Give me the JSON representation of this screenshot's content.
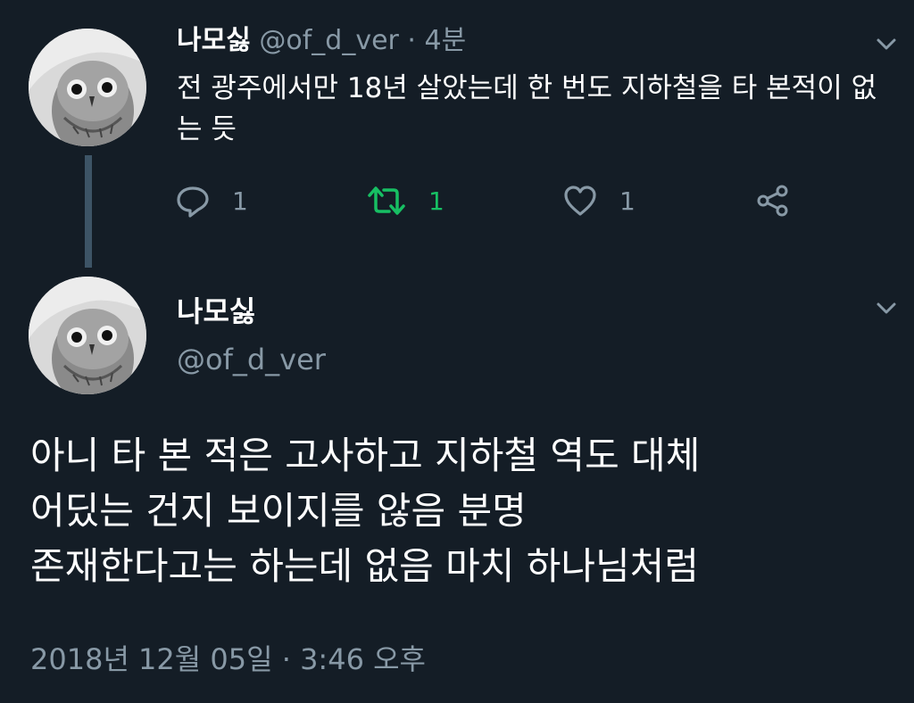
{
  "tweet1": {
    "display_name": "나모싫",
    "handle": "@of_d_ver",
    "separator": "·",
    "time_ago": "4분",
    "text": "전 광주에서만 18년 살았는데 한 번도 지하철을 타 본적이 없는 듯",
    "avatar_icon": "owl-avatar-icon",
    "actions": {
      "reply_count": "1",
      "retweet_count": "1",
      "like_count": "1"
    },
    "retweet_color": "#17bf63"
  },
  "tweet2": {
    "display_name": "나모싫",
    "handle": "@of_d_ver",
    "text": "아니 타 본 적은 고사하고 지하철 역도 대체\n어딨는 건지 보이지를 않음 분명\n존재한다고는 하는데 없음 마치 하나님처럼",
    "date": "2018년 12월 05일",
    "separator": "·",
    "time": "3:46 오후",
    "avatar_icon": "owl-avatar-icon"
  },
  "colors": {
    "background": "#141d26",
    "muted_text": "#8899a6",
    "thread_line": "#3d5466"
  }
}
